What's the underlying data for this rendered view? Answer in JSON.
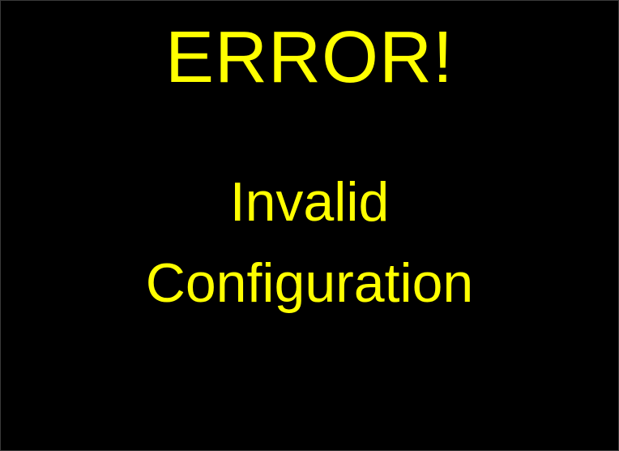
{
  "screen": {
    "background_color": "#000000",
    "text_color": "#ffff00",
    "heading": "ERROR!",
    "message_lines": [
      "Invalid",
      "Configuration"
    ]
  }
}
